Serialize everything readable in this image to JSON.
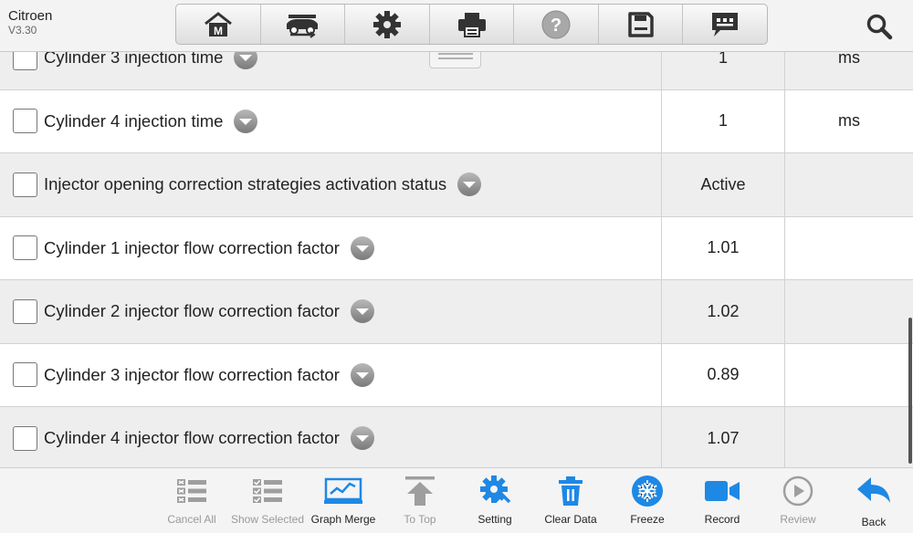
{
  "header": {
    "brand": "Citroen",
    "version": "V3.30",
    "toolbar": [
      {
        "name": "home-icon"
      },
      {
        "name": "vehicle-swap-icon"
      },
      {
        "name": "gear-icon"
      },
      {
        "name": "printer-icon"
      },
      {
        "name": "help-icon"
      },
      {
        "name": "save-icon"
      },
      {
        "name": "message-icon"
      }
    ],
    "search_icon": "search-icon"
  },
  "rows": [
    {
      "name": "Cylinder  3 injection time",
      "value": "1",
      "unit": "ms"
    },
    {
      "name": "Cylinder  4 injection time",
      "value": "1",
      "unit": "ms"
    },
    {
      "name": "Injector opening correction strategies activation status",
      "value": "Active",
      "unit": ""
    },
    {
      "name": "Cylinder 1 injector flow correction factor",
      "value": "1.01",
      "unit": ""
    },
    {
      "name": "Cylinder 2 injector flow correction factor",
      "value": "1.02",
      "unit": ""
    },
    {
      "name": "Cylinder 3 injector flow correction factor",
      "value": "0.89",
      "unit": ""
    },
    {
      "name": "Cylinder 4 injector flow correction factor",
      "value": "1.07",
      "unit": ""
    }
  ],
  "bottombar": {
    "cancel_all": "Cancel All",
    "show_selected": "Show Selected",
    "graph_merge": "Graph Merge",
    "to_top": "To Top",
    "setting": "Setting",
    "clear_data": "Clear Data",
    "freeze": "Freeze",
    "record": "Record",
    "review": "Review",
    "back": "Back"
  },
  "colors": {
    "accent_blue": "#1e88e5",
    "disabled_grey": "#9e9e9e",
    "toolbar_icon": "#333333"
  }
}
